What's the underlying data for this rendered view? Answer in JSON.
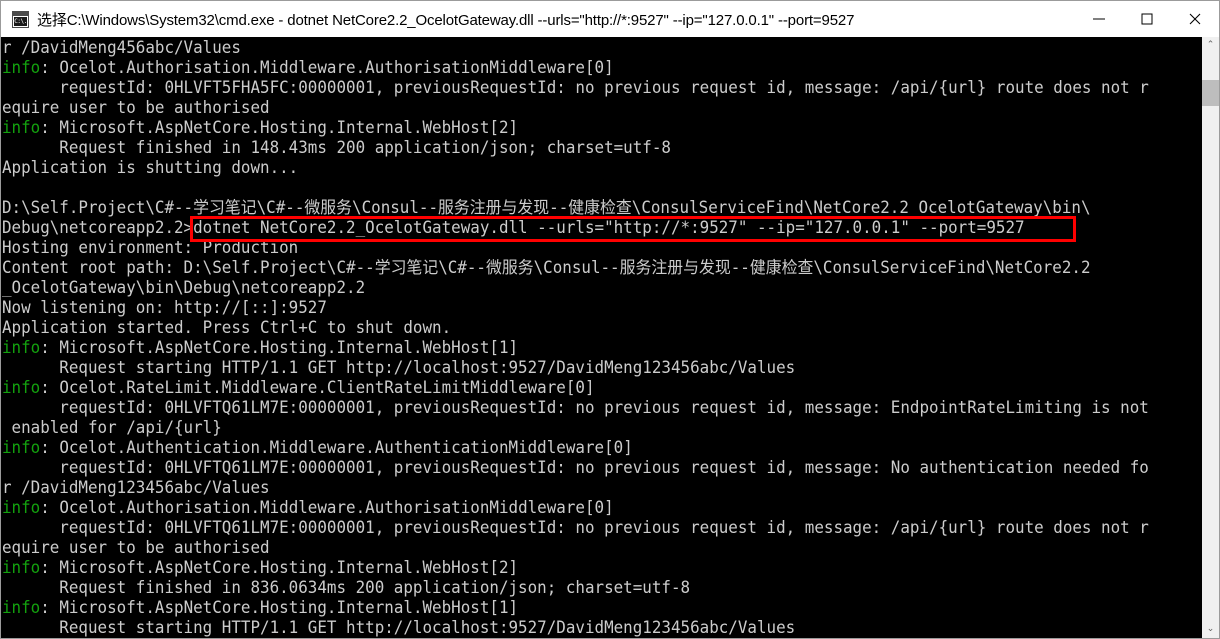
{
  "window": {
    "title": "选择C:\\Windows\\System32\\cmd.exe - dotnet  NetCore2.2_OcelotGateway.dll --urls=\"http://*:9527\" --ip=\"127.0.0.1\" --port=9527",
    "icon_label": "C:\\.",
    "controls": {
      "minimize": "minimize-button",
      "maximize": "maximize-button",
      "close": "close-button"
    }
  },
  "scrollbar": {
    "up_arrow": "⌃",
    "down_arrow": "⌄"
  },
  "annotation": {
    "color": "#ff0000",
    "highlighted_command": "dotnet NetCore2.2_OcelotGateway.dll --urls=\"http://*:9527\" --ip=\"127.0.0.1\" --port=9527"
  },
  "colors": {
    "console_background": "#000000",
    "console_foreground": "#cccccc",
    "info_green": "#13a10e",
    "annotation_red": "#ff0000",
    "titlebar_background": "#ffffff",
    "scrollbar_track": "#f0f0f0",
    "scrollbar_thumb": "#bdbdbd"
  },
  "console": {
    "lines": [
      [
        {
          "t": "r /DavidMeng456abc/Values"
        }
      ],
      [
        {
          "t": "info",
          "c": "info"
        },
        {
          "t": ": Ocelot.Authorisation.Middleware.AuthorisationMiddleware[0]"
        }
      ],
      [
        {
          "t": "      requestId: 0HLVFT5FHA5FC:00000001, previousRequestId: no previous request id, message: /api/{url} route does not r"
        }
      ],
      [
        {
          "t": "equire user to be authorised"
        }
      ],
      [
        {
          "t": "info",
          "c": "info"
        },
        {
          "t": ": Microsoft.AspNetCore.Hosting.Internal.WebHost[2]"
        }
      ],
      [
        {
          "t": "      Request finished in 148.43ms 200 application/json; charset=utf-8"
        }
      ],
      [
        {
          "t": "Application is shutting down..."
        }
      ],
      [
        {
          "t": ""
        }
      ],
      [
        {
          "t": "D:\\Self.Project\\C#--学习笔记\\C#--微服务\\Consul--服务注册与发现--健康检查\\ConsulServiceFind\\NetCore2.2_OcelotGateway\\bin\\"
        }
      ],
      [
        {
          "t": "Debug\\netcoreapp2.2>dotnet NetCore2.2_OcelotGateway.dll --urls=\"http://*:9527\" --ip=\"127.0.0.1\" --port=9527"
        }
      ],
      [
        {
          "t": "Hosting environment: Production"
        }
      ],
      [
        {
          "t": "Content root path: D:\\Self.Project\\C#--学习笔记\\C#--微服务\\Consul--服务注册与发现--健康检查\\ConsulServiceFind\\NetCore2.2"
        }
      ],
      [
        {
          "t": "_OcelotGateway\\bin\\Debug\\netcoreapp2.2"
        }
      ],
      [
        {
          "t": "Now listening on: http://[::]:9527"
        }
      ],
      [
        {
          "t": "Application started. Press Ctrl+C to shut down."
        }
      ],
      [
        {
          "t": "info",
          "c": "info"
        },
        {
          "t": ": Microsoft.AspNetCore.Hosting.Internal.WebHost[1]"
        }
      ],
      [
        {
          "t": "      Request starting HTTP/1.1 GET http://localhost:9527/DavidMeng123456abc/Values"
        }
      ],
      [
        {
          "t": "info",
          "c": "info"
        },
        {
          "t": ": Ocelot.RateLimit.Middleware.ClientRateLimitMiddleware[0]"
        }
      ],
      [
        {
          "t": "      requestId: 0HLVFTQ61LM7E:00000001, previousRequestId: no previous request id, message: EndpointRateLimiting is not"
        }
      ],
      [
        {
          "t": " enabled for /api/{url}"
        }
      ],
      [
        {
          "t": "info",
          "c": "info"
        },
        {
          "t": ": Ocelot.Authentication.Middleware.AuthenticationMiddleware[0]"
        }
      ],
      [
        {
          "t": "      requestId: 0HLVFTQ61LM7E:00000001, previousRequestId: no previous request id, message: No authentication needed fo"
        }
      ],
      [
        {
          "t": "r /DavidMeng123456abc/Values"
        }
      ],
      [
        {
          "t": "info",
          "c": "info"
        },
        {
          "t": ": Ocelot.Authorisation.Middleware.AuthorisationMiddleware[0]"
        }
      ],
      [
        {
          "t": "      requestId: 0HLVFTQ61LM7E:00000001, previousRequestId: no previous request id, message: /api/{url} route does not r"
        }
      ],
      [
        {
          "t": "equire user to be authorised"
        }
      ],
      [
        {
          "t": "info",
          "c": "info"
        },
        {
          "t": ": Microsoft.AspNetCore.Hosting.Internal.WebHost[2]"
        }
      ],
      [
        {
          "t": "      Request finished in 836.0634ms 200 application/json; charset=utf-8"
        }
      ],
      [
        {
          "t": "info",
          "c": "info"
        },
        {
          "t": ": Microsoft.AspNetCore.Hosting.Internal.WebHost[1]"
        }
      ],
      [
        {
          "t": "      Request starting HTTP/1.1 GET http://localhost:9527/DavidMeng123456abc/Values"
        }
      ]
    ]
  }
}
